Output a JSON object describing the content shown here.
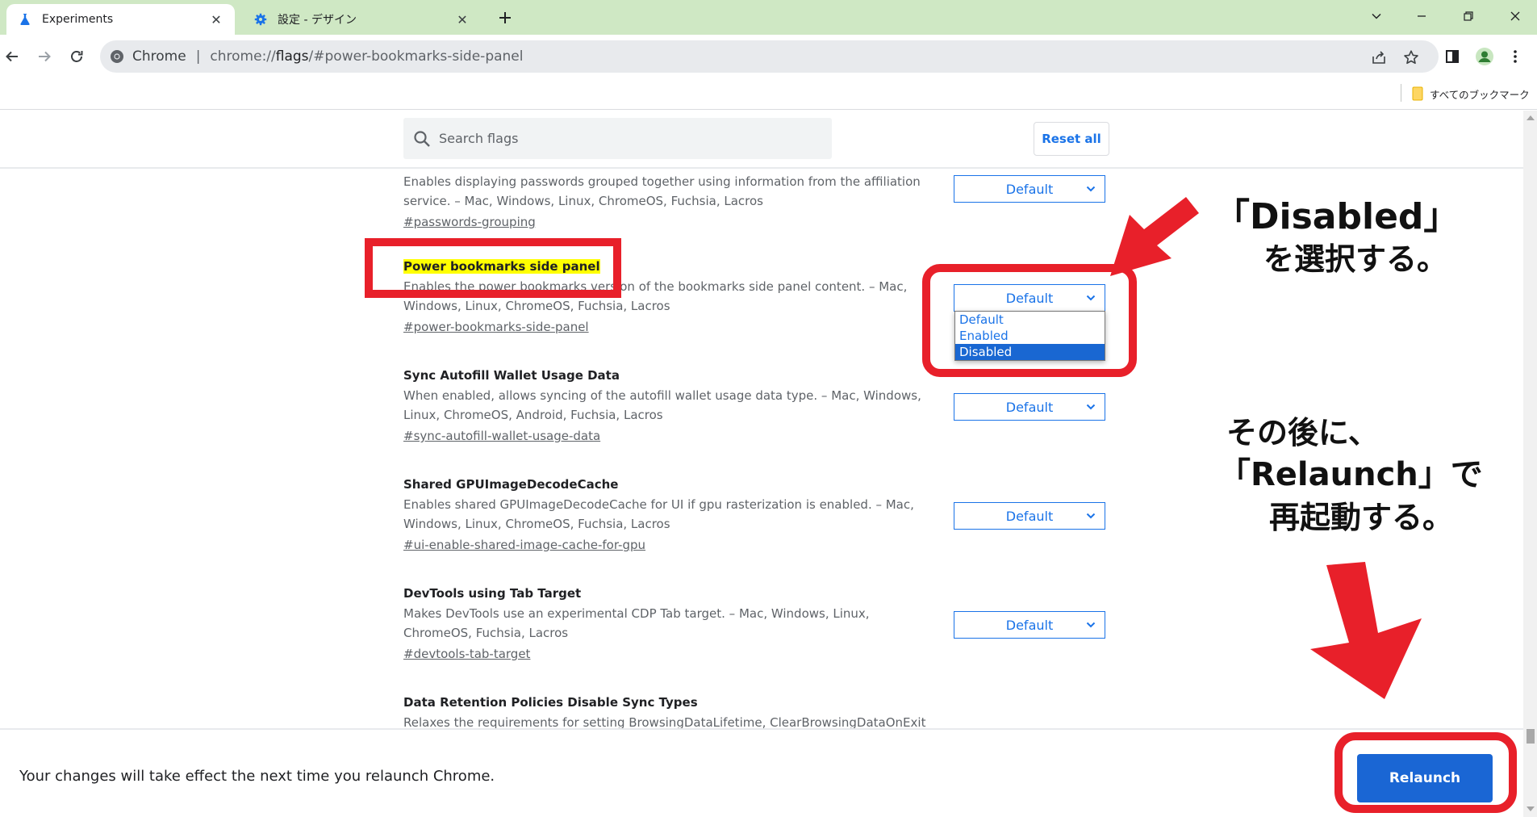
{
  "tabs": [
    {
      "title": "Experiments",
      "active": true
    },
    {
      "title": "設定 - デザイン",
      "active": false
    }
  ],
  "omnibox": {
    "site_label": "Chrome",
    "separator": "|",
    "url_host": "chrome://",
    "url_bold": "flags",
    "url_rest": "/#power-bookmarks-side-panel"
  },
  "bookmarks_bar": {
    "all_bookmarks": "すべてのブックマーク"
  },
  "search": {
    "placeholder": "Search flags",
    "reset_label": "Reset all"
  },
  "flags": [
    {
      "name": "",
      "description": "Enables displaying passwords grouped together using information from the affiliation service. – Mac, Windows, Linux, ChromeOS, Fuchsia, Lacros",
      "link": "#passwords-grouping",
      "value": "Default"
    },
    {
      "name": "Power bookmarks side panel",
      "description": "Enables the power bookmarks version of the bookmarks side panel content. – Mac, Windows, Linux, ChromeOS, Fuchsia, Lacros",
      "link": "#power-bookmarks-side-panel",
      "value": "Default"
    },
    {
      "name": "Sync Autofill Wallet Usage Data",
      "description": "When enabled, allows syncing of the autofill wallet usage data type. – Mac, Windows, Linux, ChromeOS, Android, Fuchsia, Lacros",
      "link": "#sync-autofill-wallet-usage-data",
      "value": "Default"
    },
    {
      "name": "Shared GPUImageDecodeCache",
      "description": "Enables shared GPUImageDecodeCache for UI if gpu rasterization is enabled. – Mac, Windows, Linux, ChromeOS, Fuchsia, Lacros",
      "link": "#ui-enable-shared-image-cache-for-gpu",
      "value": "Default"
    },
    {
      "name": "DevTools using Tab Target",
      "description": "Makes DevTools use an experimental CDP Tab target. – Mac, Windows, Linux, ChromeOS, Fuchsia, Lacros",
      "link": "#devtools-tab-target",
      "value": "Default"
    },
    {
      "name": "Data Retention Policies Disable Sync Types",
      "description": "Relaxes the requirements for setting BrowsingDataLifetime, ClearBrowsingDataOnExit and",
      "link": "",
      "value": ""
    }
  ],
  "dropdown": {
    "options": [
      "Default",
      "Enabled",
      "Disabled"
    ],
    "highlighted": "Disabled"
  },
  "relaunch": {
    "message": "Your changes will take effect the next time you relaunch Chrome.",
    "button_label": "Relaunch"
  },
  "annotations": {
    "select_line1": "「Disabled」",
    "select_line2": "を選択する。",
    "relaunch_line1": "その後に、",
    "relaunch_line2": "「Relaunch」で",
    "relaunch_line3": "再起動する。"
  },
  "colors": {
    "titlebar_bg": "#cfe8c4",
    "accent_blue": "#1a73e8",
    "highlight_yellow": "#ffff00",
    "annotation_red": "#e8202a",
    "relaunch_button": "#1a66d4"
  }
}
